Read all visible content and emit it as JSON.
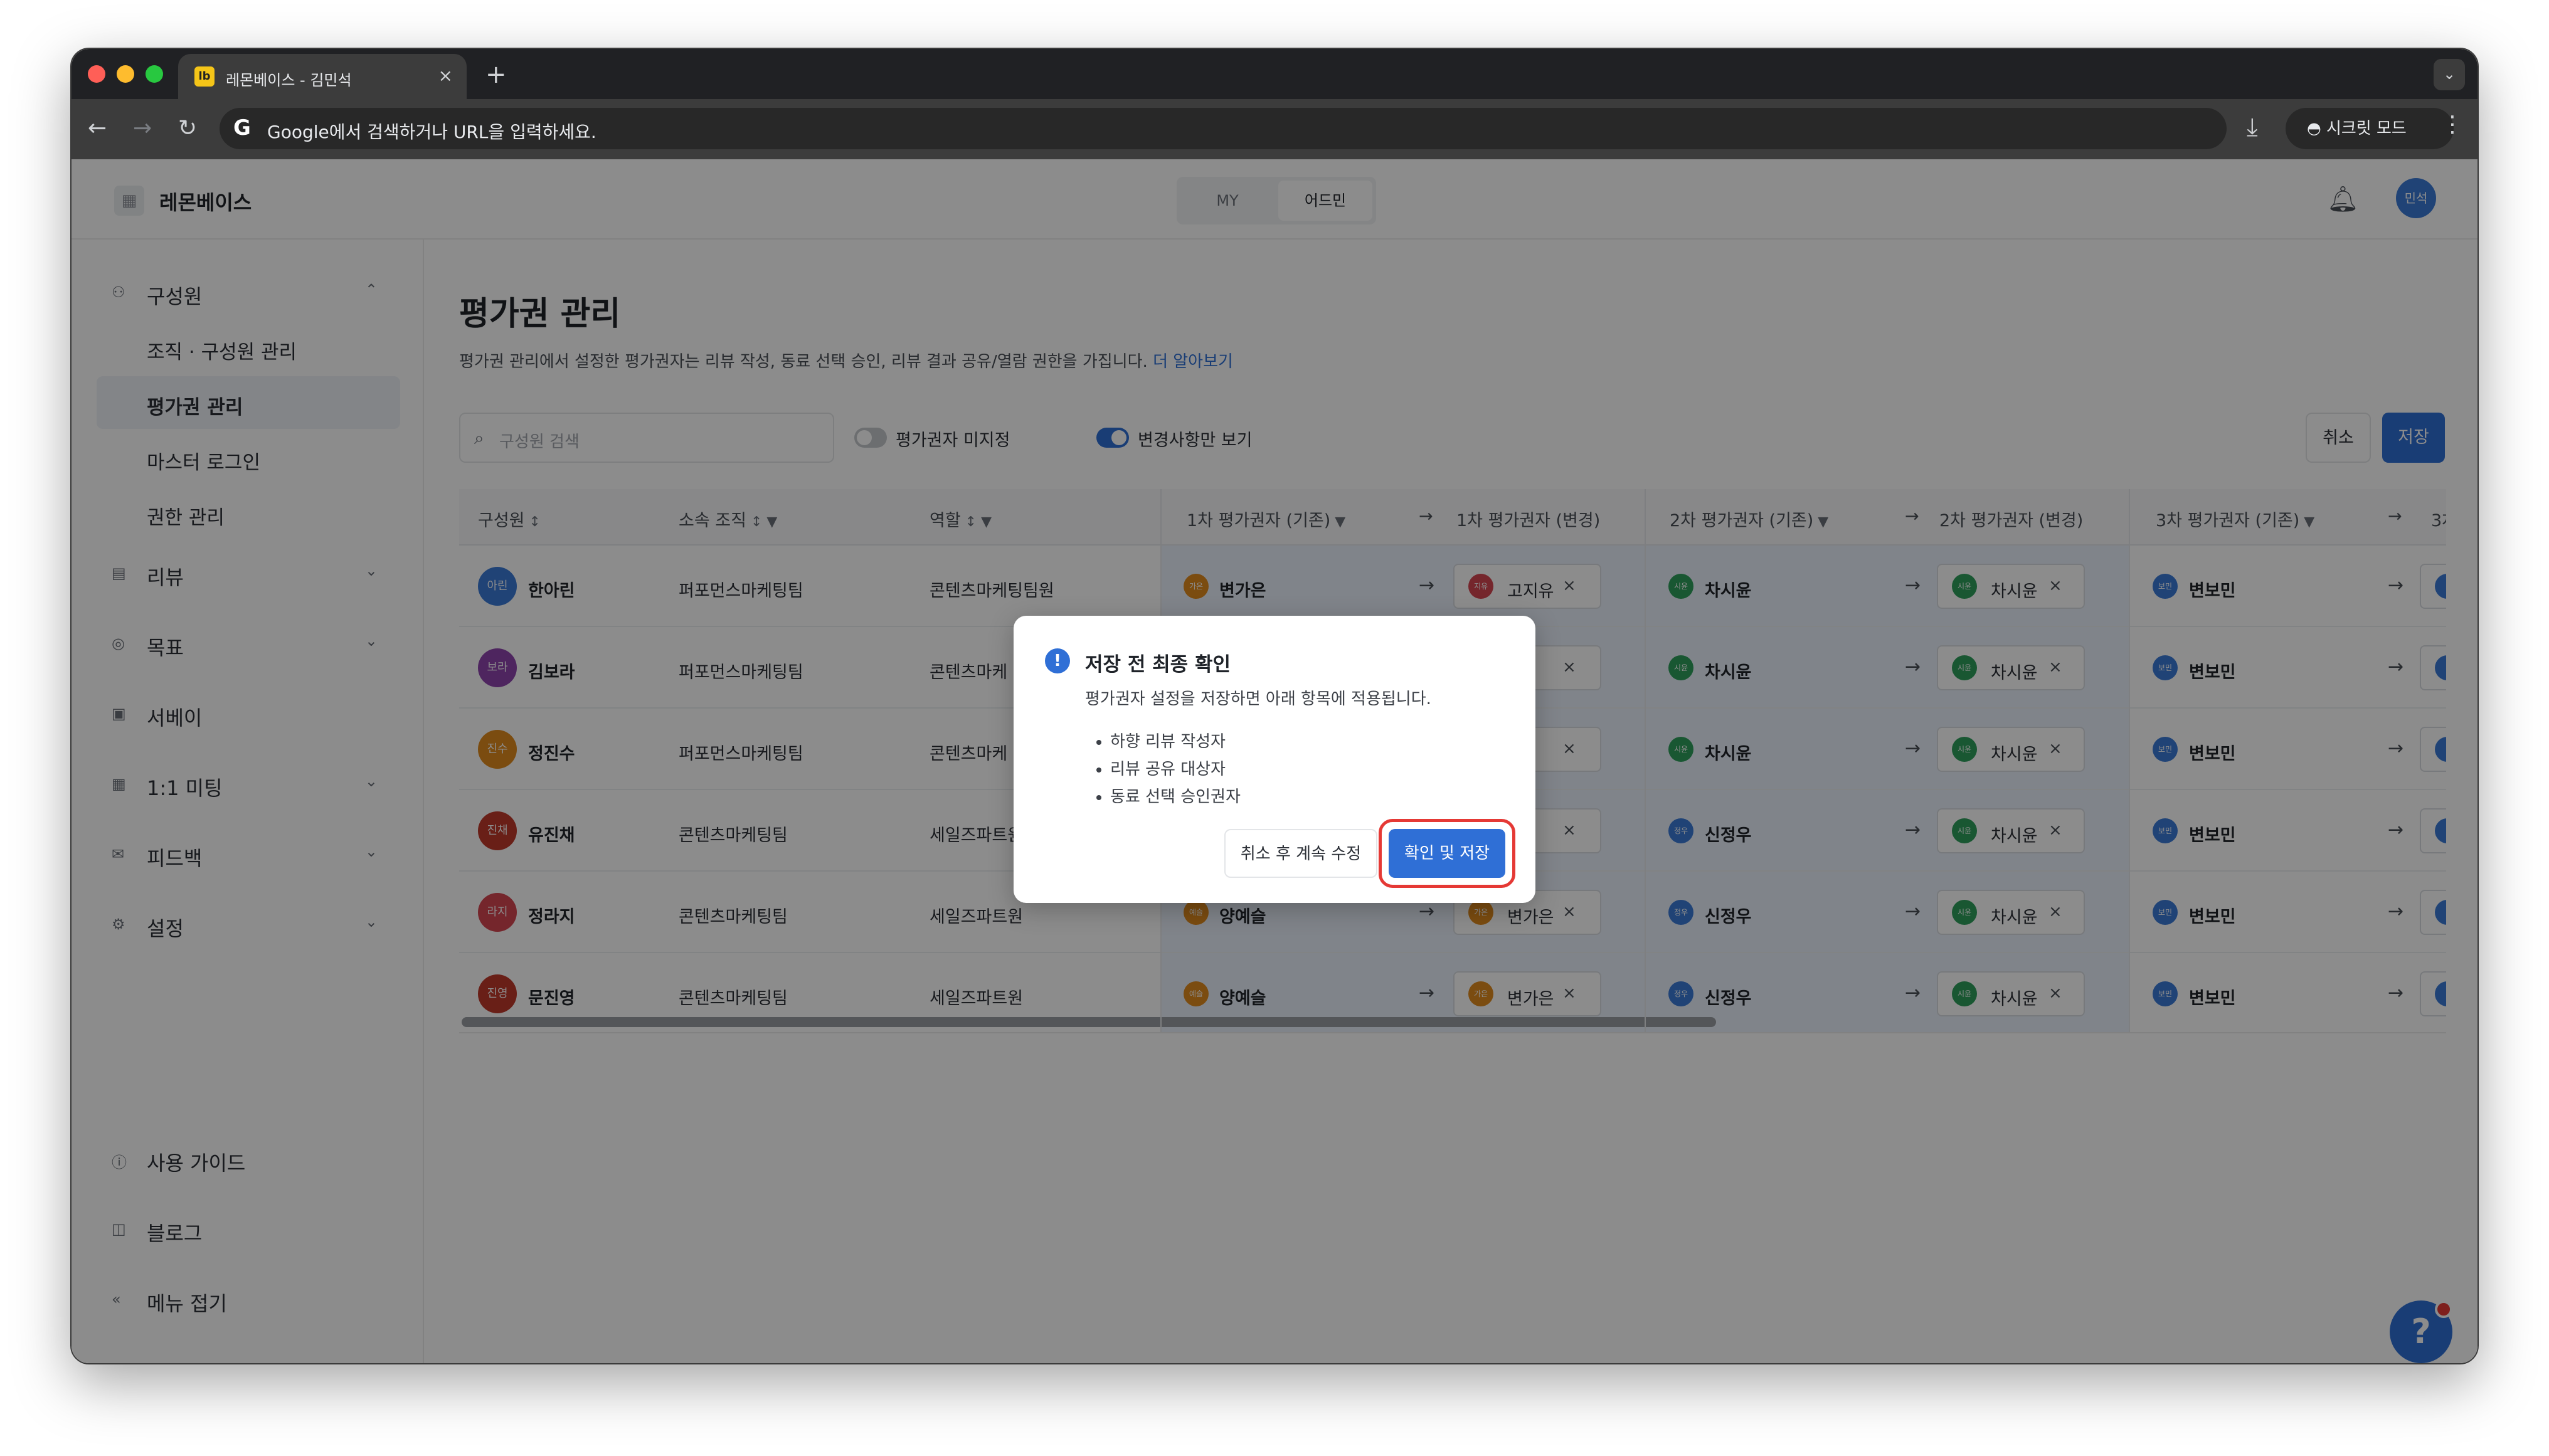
{
  "browser": {
    "tab_title": "레몬베이스 - 김민석",
    "tab_favicon": "lb",
    "new_tab": "+",
    "address_placeholder": "Google에서 검색하거나 URL을 입력하세요.",
    "incognito_label": "시크릿 모드"
  },
  "header": {
    "brand": "레몬베이스",
    "segments": [
      "MY",
      "어드민"
    ],
    "active_segment": "어드민",
    "user_avatar": "민석"
  },
  "sidebar": {
    "groups": [
      {
        "label": "구성원",
        "icon": "person-icon",
        "expanded": true
      },
      {
        "label": "리뷰",
        "icon": "document-icon"
      },
      {
        "label": "목표",
        "icon": "target-icon"
      },
      {
        "label": "서베이",
        "icon": "survey-icon"
      },
      {
        "label": "1:1 미팅",
        "icon": "calendar-icon"
      },
      {
        "label": "피드백",
        "icon": "mail-icon"
      },
      {
        "label": "설정",
        "icon": "gear-icon"
      }
    ],
    "sub_items": [
      "조직 · 구성원 관리",
      "평가권 관리",
      "마스터 로그인",
      "권한 관리"
    ],
    "selected_sub": "평가권 관리",
    "footer": [
      {
        "label": "사용 가이드",
        "icon": "help-circle-icon"
      },
      {
        "label": "블로그",
        "icon": "book-icon"
      },
      {
        "label": "메뉴 접기",
        "icon": "collapse-icon"
      }
    ]
  },
  "page": {
    "title": "평가권 관리",
    "description": "평가권 관리에서 설정한 평가권자는 리뷰 작성, 동료 선택 승인, 리뷰 결과 공유/열람 권한을 가집니다.",
    "learn_more": "더 알아보기",
    "search_placeholder": "구성원 검색",
    "toggle_unassigned": "평가권자 미지정",
    "toggle_changes_only": "변경사항만 보기",
    "cancel_label": "취소",
    "save_label": "저장"
  },
  "table": {
    "columns": [
      "구성원",
      "소속 조직",
      "역할",
      "1차 평가권자 (기존)",
      "1차 평가권자 (변경)",
      "2차 평가권자 (기존)",
      "2차 평가권자 (변경)",
      "3차 평가권자 (기존)",
      "3차"
    ],
    "rows": [
      {
        "avatar": "아린",
        "color": "#3b7ad8",
        "name": "한아린",
        "org": "퍼포먼스마케팅팀",
        "role": "콘텐츠마케팅팀원",
        "r1_old": "변가은",
        "r1_old_av": "가은",
        "r1_new": "고지유",
        "r1_new_av": "지유",
        "r2_old": "차시윤",
        "r2_old_av": "시윤",
        "r2_new": "차시윤",
        "r2_new_av": "시윤",
        "r3_old": "변보민",
        "r3_old_av": "보민"
      },
      {
        "avatar": "보라",
        "color": "#8e44ad",
        "name": "김보라",
        "org": "퍼포먼스마케팅팀",
        "role": "콘텐츠마케",
        "r1_old": "",
        "r1_old_av": "",
        "r1_new": "유",
        "r1_new_av": "",
        "r2_old": "차시윤",
        "r2_old_av": "시윤",
        "r2_new": "차시윤",
        "r2_new_av": "시윤",
        "r3_old": "변보민",
        "r3_old_av": "보민"
      },
      {
        "avatar": "진수",
        "color": "#e08a1e",
        "name": "정진수",
        "org": "퍼포먼스마케팅팀",
        "role": "콘텐츠마케",
        "r1_old": "",
        "r1_old_av": "",
        "r1_new": "유",
        "r1_new_av": "",
        "r2_old": "차시윤",
        "r2_old_av": "시윤",
        "r2_new": "차시윤",
        "r2_new_av": "시윤",
        "r3_old": "변보민",
        "r3_old_av": "보민"
      },
      {
        "avatar": "진채",
        "color": "#c0392b",
        "name": "유진채",
        "org": "콘텐츠마케팅팀",
        "role": "세일즈파트원",
        "r1_old": "",
        "r1_old_av": "",
        "r1_new": "은",
        "r1_new_av": "",
        "r2_old": "신정우",
        "r2_old_av": "정우",
        "r2_new": "차시윤",
        "r2_new_av": "시윤",
        "r3_old": "변보민",
        "r3_old_av": "보민"
      },
      {
        "avatar": "라지",
        "color": "#d64550",
        "name": "정라지",
        "org": "콘텐츠마케팅팀",
        "role": "세일즈파트원",
        "r1_old": "양예슬",
        "r1_old_av": "예슬",
        "r1_new": "변가은",
        "r1_new_av": "가은",
        "r2_old": "신정우",
        "r2_old_av": "정우",
        "r2_new": "차시윤",
        "r2_new_av": "시윤",
        "r3_old": "변보민",
        "r3_old_av": "보민"
      },
      {
        "avatar": "진영",
        "color": "#c0392b",
        "name": "문진영",
        "org": "콘텐츠마케팅팀",
        "role": "세일즈파트원",
        "r1_old": "양예슬",
        "r1_old_av": "예슬",
        "r1_new": "변가은",
        "r1_new_av": "가은",
        "r2_old": "신정우",
        "r2_old_av": "정우",
        "r2_new": "차시윤",
        "r2_new_av": "시윤",
        "r3_old": "변보민",
        "r3_old_av": "보민"
      }
    ]
  },
  "modal": {
    "title": "저장 전 최종 확인",
    "description": "평가권자 설정을 저장하면 아래 항목에 적용됩니다.",
    "items": [
      "하향 리뷰 작성자",
      "리뷰 공유 대상자",
      "동료 선택 승인권자"
    ],
    "secondary_button": "취소 후 계속 수정",
    "primary_button": "확인 및 저장"
  },
  "colors": {
    "accent": "#2f6fd6",
    "highlight_ring": "#e53935"
  }
}
